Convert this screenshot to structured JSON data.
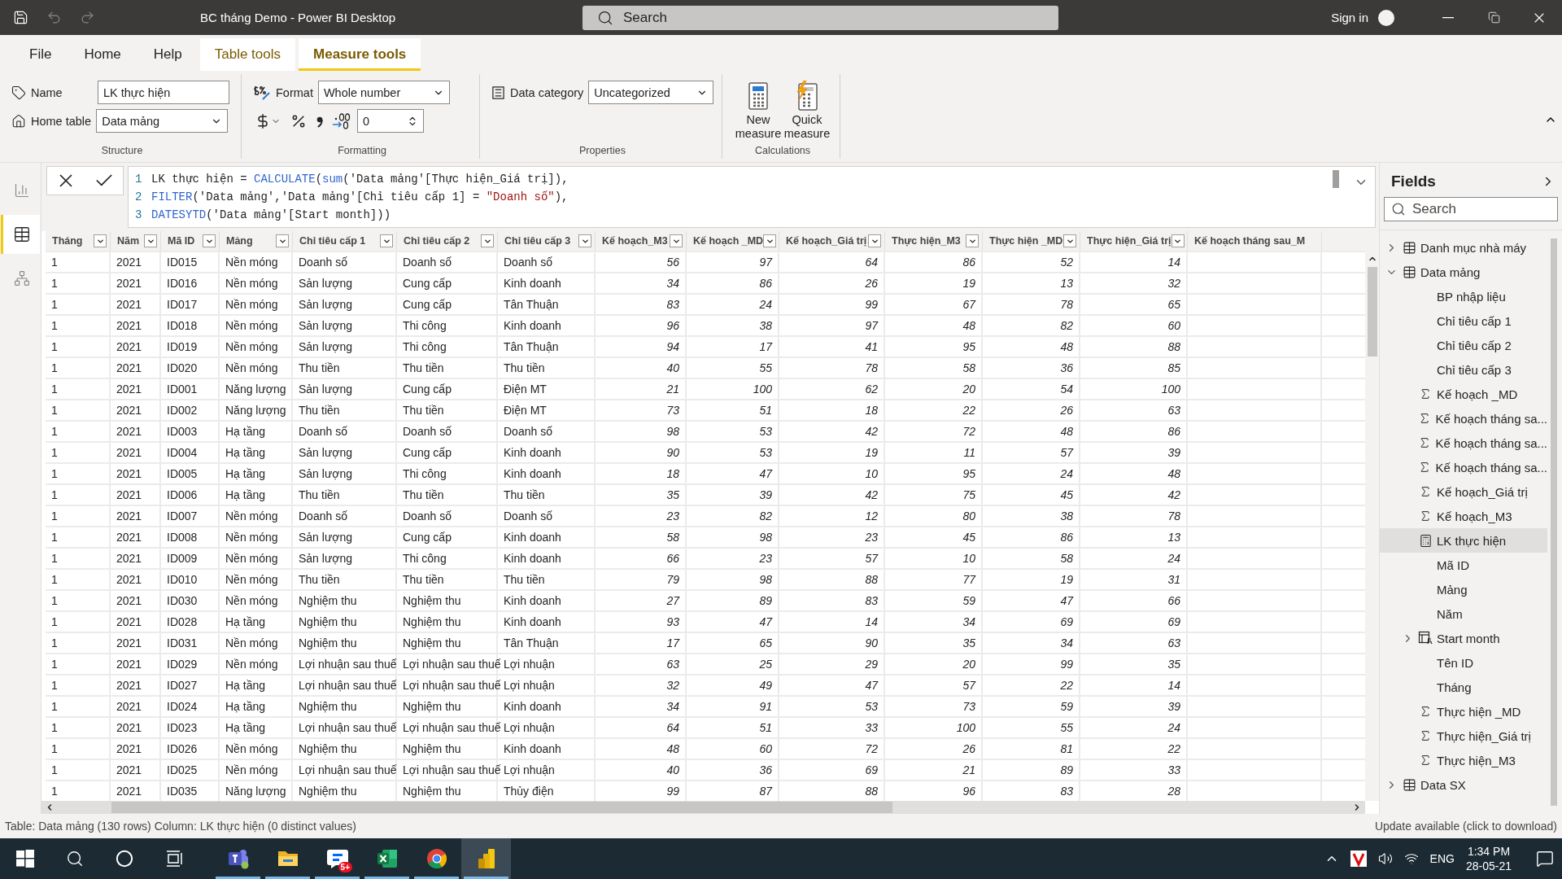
{
  "title_bar": {
    "title": "BC tháng Demo - Power BI Desktop",
    "search_placeholder": "Search",
    "sign_in": "Sign in"
  },
  "ribbon_tabs": [
    {
      "label": "File",
      "kind": "normal",
      "selected": false
    },
    {
      "label": "Home",
      "kind": "normal",
      "selected": false
    },
    {
      "label": "Help",
      "kind": "normal",
      "selected": false
    },
    {
      "label": "Table tools",
      "kind": "contextual",
      "selected": false
    },
    {
      "label": "Measure tools",
      "kind": "contextual",
      "selected": true
    }
  ],
  "structure": {
    "label": "Structure",
    "name_label": "Name",
    "name_value": "LK thực hiện",
    "home_table_label": "Home table",
    "home_table_value": "Data mảng"
  },
  "formatting": {
    "label": "Formatting",
    "format_label": "Format",
    "format_value": "Whole number",
    "decimal_places": "0"
  },
  "properties": {
    "label": "Properties",
    "data_category_label": "Data category",
    "data_category_value": "Uncategorized"
  },
  "calculations": {
    "label": "Calculations",
    "buttons": [
      {
        "label": "New measure",
        "kind": "new"
      },
      {
        "label": "Quick measure",
        "kind": "quick"
      }
    ]
  },
  "views": [
    {
      "kind": "report",
      "selected": false
    },
    {
      "kind": "data",
      "selected": true
    },
    {
      "kind": "model",
      "selected": false
    }
  ],
  "formula": {
    "lines": [
      {
        "number": "1",
        "tokens": [
          {
            "text": "LK thực hiện = ",
            "kind": "plain"
          },
          {
            "text": "CALCULATE",
            "kind": "func"
          },
          {
            "text": "(",
            "kind": "plain"
          },
          {
            "text": "sum",
            "kind": "func"
          },
          {
            "text": "('Data mảng'[Thực hiện_Giá trị]),",
            "kind": "plain"
          }
        ]
      },
      {
        "number": "2",
        "tokens": [
          {
            "text": "FILTER",
            "kind": "func"
          },
          {
            "text": "('Data mảng','Data mảng'[Chỉ tiêu cấp 1] = ",
            "kind": "plain"
          },
          {
            "text": "\"Doanh số\"",
            "kind": "string"
          },
          {
            "text": "),",
            "kind": "plain"
          }
        ]
      },
      {
        "number": "3",
        "tokens": [
          {
            "text": "DATESYTD",
            "kind": "func"
          },
          {
            "text": "('Data mảng'[Start month]))",
            "kind": "plain"
          }
        ]
      }
    ]
  },
  "table": {
    "columns": [
      {
        "label": "Tháng",
        "kind": "text"
      },
      {
        "label": "Năm",
        "kind": "text"
      },
      {
        "label": "Mã ID",
        "kind": "text"
      },
      {
        "label": "Mảng",
        "kind": "text"
      },
      {
        "label": "Chỉ tiêu cấp 1",
        "kind": "text"
      },
      {
        "label": "Chỉ tiêu cấp 2",
        "kind": "text"
      },
      {
        "label": "Chỉ tiêu cấp 3",
        "kind": "text"
      },
      {
        "label": "Kế hoạch_M3",
        "kind": "number"
      },
      {
        "label": "Kế hoạch _MD",
        "kind": "number"
      },
      {
        "label": "Kế hoạch_Giá trị",
        "kind": "number"
      },
      {
        "label": "Thực hiện_M3",
        "kind": "number"
      },
      {
        "label": "Thực hiện _MD",
        "kind": "number"
      },
      {
        "label": "Thực hiện_Giá trị",
        "kind": "number"
      },
      {
        "label": "Kế hoạch tháng sau_M"
      }
    ],
    "rows": [
      [
        "1",
        "2021",
        "ID015",
        "Nền móng",
        "Doanh số",
        "Doanh số",
        "Doanh số",
        "56",
        "97",
        "64",
        "86",
        "52",
        "14"
      ],
      [
        "1",
        "2021",
        "ID016",
        "Nền móng",
        "Sản lượng",
        "Cung cấp",
        "Kinh doanh",
        "34",
        "86",
        "26",
        "19",
        "13",
        "32"
      ],
      [
        "1",
        "2021",
        "ID017",
        "Nền móng",
        "Sản lượng",
        "Cung cấp",
        "Tân Thuận",
        "83",
        "24",
        "99",
        "67",
        "78",
        "65"
      ],
      [
        "1",
        "2021",
        "ID018",
        "Nền móng",
        "Sản lượng",
        "Thi công",
        "Kinh doanh",
        "96",
        "38",
        "97",
        "48",
        "82",
        "60"
      ],
      [
        "1",
        "2021",
        "ID019",
        "Nền móng",
        "Sản lượng",
        "Thi công",
        "Tân Thuận",
        "94",
        "17",
        "41",
        "95",
        "48",
        "88"
      ],
      [
        "1",
        "2021",
        "ID020",
        "Nền móng",
        "Thu tiền",
        "Thu tiền",
        "Thu tiền",
        "40",
        "55",
        "78",
        "58",
        "36",
        "85"
      ],
      [
        "1",
        "2021",
        "ID001",
        "Năng lượng",
        "Sản lượng",
        "Cung cấp",
        "Điện MT",
        "21",
        "100",
        "62",
        "20",
        "54",
        "100"
      ],
      [
        "1",
        "2021",
        "ID002",
        "Năng lượng",
        "Thu tiền",
        "Thu tiền",
        "Điện MT",
        "73",
        "51",
        "18",
        "22",
        "26",
        "63"
      ],
      [
        "1",
        "2021",
        "ID003",
        "Hạ tầng",
        "Doanh số",
        "Doanh số",
        "Doanh số",
        "98",
        "53",
        "42",
        "72",
        "48",
        "86"
      ],
      [
        "1",
        "2021",
        "ID004",
        "Hạ tầng",
        "Sản lượng",
        "Cung cấp",
        "Kinh doanh",
        "90",
        "53",
        "19",
        "11",
        "57",
        "39"
      ],
      [
        "1",
        "2021",
        "ID005",
        "Hạ tầng",
        "Sản lượng",
        "Thi công",
        "Kinh doanh",
        "18",
        "47",
        "10",
        "95",
        "24",
        "48"
      ],
      [
        "1",
        "2021",
        "ID006",
        "Hạ tầng",
        "Thu tiền",
        "Thu tiền",
        "Thu tiền",
        "35",
        "39",
        "42",
        "75",
        "45",
        "42"
      ],
      [
        "1",
        "2021",
        "ID007",
        "Nền móng",
        "Doanh số",
        "Doanh số",
        "Doanh số",
        "23",
        "82",
        "12",
        "80",
        "38",
        "78"
      ],
      [
        "1",
        "2021",
        "ID008",
        "Nền móng",
        "Sản lượng",
        "Cung cấp",
        "Kinh doanh",
        "58",
        "98",
        "23",
        "45",
        "86",
        "13"
      ],
      [
        "1",
        "2021",
        "ID009",
        "Nền móng",
        "Sản lượng",
        "Thi công",
        "Kinh doanh",
        "66",
        "23",
        "57",
        "10",
        "58",
        "24"
      ],
      [
        "1",
        "2021",
        "ID010",
        "Nền móng",
        "Thu tiền",
        "Thu tiền",
        "Thu tiền",
        "79",
        "98",
        "88",
        "77",
        "19",
        "31"
      ],
      [
        "1",
        "2021",
        "ID030",
        "Nền móng",
        "Nghiệm thu",
        "Nghiệm thu",
        "Kinh doanh",
        "27",
        "89",
        "83",
        "59",
        "47",
        "66"
      ],
      [
        "1",
        "2021",
        "ID028",
        "Hạ tầng",
        "Nghiệm thu",
        "Nghiệm thu",
        "Kinh doanh",
        "93",
        "47",
        "14",
        "34",
        "69",
        "69"
      ],
      [
        "1",
        "2021",
        "ID031",
        "Nền móng",
        "Nghiệm thu",
        "Nghiệm thu",
        "Tân Thuận",
        "17",
        "65",
        "90",
        "35",
        "34",
        "63"
      ],
      [
        "1",
        "2021",
        "ID029",
        "Nền móng",
        "Lợi nhuận sau thuế",
        "Lợi nhuận sau thuế",
        "Lợi nhuận",
        "63",
        "25",
        "29",
        "20",
        "99",
        "35"
      ],
      [
        "1",
        "2021",
        "ID027",
        "Hạ tầng",
        "Lợi nhuận sau thuế",
        "Lợi nhuận sau thuế",
        "Lợi nhuận",
        "32",
        "49",
        "47",
        "57",
        "22",
        "14"
      ],
      [
        "1",
        "2021",
        "ID024",
        "Hạ tầng",
        "Nghiệm thu",
        "Nghiệm thu",
        "Kinh doanh",
        "34",
        "91",
        "53",
        "73",
        "59",
        "39"
      ],
      [
        "1",
        "2021",
        "ID023",
        "Hạ tầng",
        "Lợi nhuận sau thuế",
        "Lợi nhuận sau thuế",
        "Lợi nhuận",
        "64",
        "51",
        "33",
        "100",
        "55",
        "24"
      ],
      [
        "1",
        "2021",
        "ID026",
        "Nền móng",
        "Nghiệm thu",
        "Nghiệm thu",
        "Kinh doanh",
        "48",
        "60",
        "72",
        "26",
        "81",
        "22"
      ],
      [
        "1",
        "2021",
        "ID025",
        "Nền móng",
        "Lợi nhuận sau thuế",
        "Lợi nhuận sau thuế",
        "Lợi nhuận",
        "40",
        "36",
        "69",
        "21",
        "89",
        "33"
      ],
      [
        "1",
        "2021",
        "ID035",
        "Năng lượng",
        "Nghiệm thu",
        "Nghiệm thu",
        "Thủy điện",
        "99",
        "87",
        "88",
        "96",
        "83",
        "28"
      ]
    ]
  },
  "fields": {
    "title": "Fields",
    "search_placeholder": "Search",
    "items": [
      {
        "label": "Danh mục nhà máy",
        "kind": "table",
        "expanded": false,
        "selected": false
      },
      {
        "label": "Data mảng",
        "kind": "table",
        "expanded": true,
        "selected": false,
        "children": [
          {
            "label": "BP nhập liệu",
            "kind": "column",
            "selected": false
          },
          {
            "label": "Chỉ tiêu cấp 1",
            "kind": "column",
            "selected": false
          },
          {
            "label": "Chỉ tiêu cấp 2",
            "kind": "column",
            "selected": false
          },
          {
            "label": "Chỉ tiêu cấp 3",
            "kind": "column",
            "selected": false
          },
          {
            "label": "Kế hoạch _MD",
            "kind": "sum",
            "selected": false
          },
          {
            "label": "Kế hoạch tháng sa...",
            "kind": "sum",
            "selected": false
          },
          {
            "label": "Kế hoạch tháng sa...",
            "kind": "sum",
            "selected": false
          },
          {
            "label": "Kế hoạch tháng sa...",
            "kind": "sum",
            "selected": false
          },
          {
            "label": "Kế hoạch_Giá trị",
            "kind": "sum",
            "selected": false
          },
          {
            "label": "Kế hoạch_M3",
            "kind": "sum",
            "selected": false
          },
          {
            "label": "LK thực hiện",
            "kind": "measure",
            "selected": true
          },
          {
            "label": "Mã ID",
            "kind": "column",
            "selected": false
          },
          {
            "label": "Mảng",
            "kind": "column",
            "selected": false
          },
          {
            "label": "Năm",
            "kind": "column",
            "selected": false
          },
          {
            "label": "Start month",
            "kind": "date",
            "expanded": false,
            "selected": false
          },
          {
            "label": "Tên ID",
            "kind": "column",
            "selected": false
          },
          {
            "label": "Tháng",
            "kind": "column",
            "selected": false
          },
          {
            "label": "Thực hiện _MD",
            "kind": "sum",
            "selected": false
          },
          {
            "label": "Thực hiện_Giá trị",
            "kind": "sum",
            "selected": false
          },
          {
            "label": "Thực hiện_M3",
            "kind": "sum",
            "selected": false
          }
        ]
      },
      {
        "label": "Data SX",
        "kind": "table",
        "expanded": false,
        "selected": false
      }
    ]
  },
  "status_bar": {
    "left": "Table: Data mảng (130 rows) Column: LK thực hiện (0 distinct values)",
    "right": "Update available (click to download)"
  },
  "taskbar": {
    "apps": [
      {
        "kind": "teams",
        "open": true,
        "active": false
      },
      {
        "kind": "explorer",
        "open": true,
        "active": false
      },
      {
        "kind": "chat",
        "open": true,
        "active": false,
        "badge": "5+"
      },
      {
        "kind": "excel",
        "open": true,
        "active": false
      },
      {
        "kind": "chrome",
        "open": true,
        "active": false
      },
      {
        "kind": "powerbi",
        "open": true,
        "active": true
      }
    ],
    "language": "ENG",
    "time": "1:34 PM",
    "date": "28-05-21"
  }
}
